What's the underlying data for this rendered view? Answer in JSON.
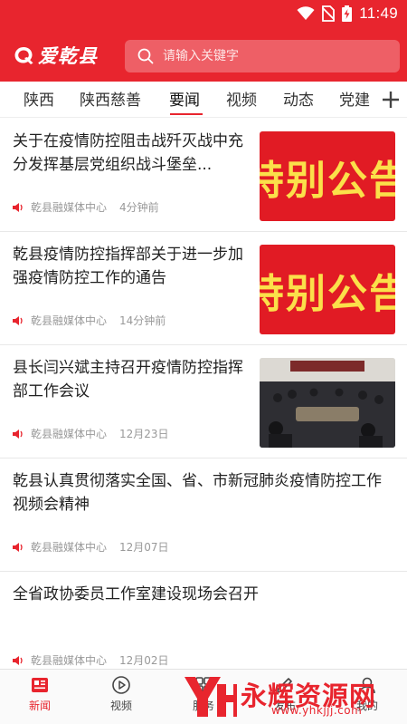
{
  "status_bar": {
    "time": "11:49"
  },
  "header": {
    "logo_text": "爱乾县",
    "search_placeholder": "请输入关键字",
    "colors": {
      "brand": "#e8252e"
    }
  },
  "tabs": [
    {
      "label": "陕西"
    },
    {
      "label": "陕西慈善"
    },
    {
      "label": "要闻",
      "active": true
    },
    {
      "label": "视频"
    },
    {
      "label": "动态"
    },
    {
      "label": "党建"
    }
  ],
  "news": [
    {
      "title": "关于在疫情防控阻击战歼灭战中充分发挥基层党组织战斗堡垒...",
      "source": "乾县融媒体中心",
      "time": "4分钟前",
      "thumb": "red",
      "thumb_text": "特别公告"
    },
    {
      "title": "乾县疫情防控指挥部关于进一步加强疫情防控工作的通告",
      "source": "乾县融媒体中心",
      "time": "14分钟前",
      "thumb": "red",
      "thumb_text": "特别公告"
    },
    {
      "title": "县长闫兴斌主持召开疫情防控指挥部工作会议",
      "source": "乾县融媒体中心",
      "time": "12月23日",
      "thumb": "photo"
    },
    {
      "title": "乾县认真贯彻落实全国、省、市新冠肺炎疫情防控工作视频会精神",
      "source": "乾县融媒体中心",
      "time": "12月07日"
    },
    {
      "title": "全省政协委员工作室建设现场会召开",
      "source": "乾县融媒体中心",
      "time": "12月02日"
    }
  ],
  "bottom_nav": [
    {
      "label": "新闻",
      "icon": "news-icon",
      "active": true
    },
    {
      "label": "视频",
      "icon": "play-icon"
    },
    {
      "label": "服务",
      "icon": "service-icon"
    },
    {
      "label": "发布",
      "icon": "publish-icon"
    },
    {
      "label": "我的",
      "icon": "profile-icon"
    }
  ],
  "watermark": {
    "text": "永辉资源网",
    "url": "www.yhkjjj.com"
  }
}
